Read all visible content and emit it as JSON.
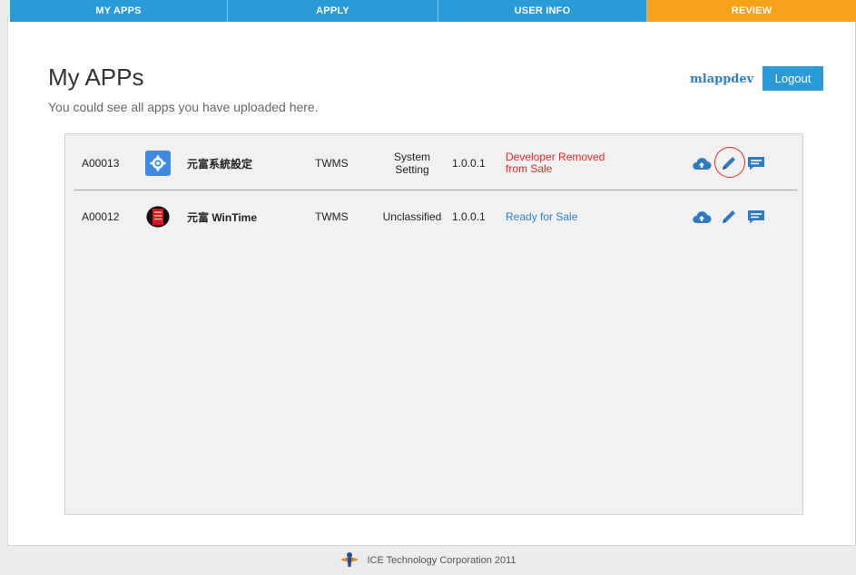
{
  "nav": {
    "tabs": [
      {
        "label": "MY APPS"
      },
      {
        "label": "APPLY"
      },
      {
        "label": "USER INFO"
      },
      {
        "label": "REVIEW"
      }
    ]
  },
  "header": {
    "title": "My APPs",
    "subtitle": "You could see all apps you have uploaded here.",
    "username": "mlappdev",
    "logout_label": "Logout"
  },
  "apps": [
    {
      "id": "A00013",
      "icon": "settings-gear-icon",
      "name": "元富系統設定",
      "vendor": "TWMS",
      "category_line1": "System",
      "category_line2": "Setting",
      "version": "1.0.0.1",
      "status_line1": "Developer Removed",
      "status_line2": "from Sale",
      "status_color": "#e3282a"
    },
    {
      "id": "A00012",
      "icon": "wintime-logo-icon",
      "name": "元富 WinTime",
      "vendor": "TWMS",
      "category_line1": "Unclassified",
      "category_line2": "",
      "version": "1.0.0.1",
      "status_line1": "Ready for Sale",
      "status_line2": "",
      "status_color": "#2d80c8"
    }
  ],
  "footer": {
    "text": "ICE Technology Corporation 2011"
  },
  "colors": {
    "nav_blue": "#2b9ad8",
    "nav_orange": "#f7a21d",
    "link_blue": "#2d80c8",
    "error_red": "#e3282a"
  }
}
